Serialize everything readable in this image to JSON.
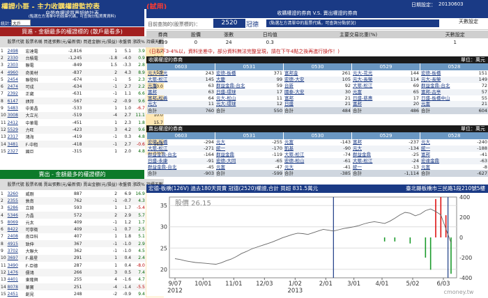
{
  "app": {
    "title": "權證小哥 - 主力收購權證監控表",
    "title_tag": "(試用)",
    "date_label": "日期設定：",
    "date": "20130603"
  },
  "left": {
    "subtitle": "自營商權證買賣超統計表",
    "subtitle2": "(點選左方清單中的股票代碼，可查詢分點買賣資料)",
    "select_label": "統計：",
    "select_value": "大戶",
    "buy": {
      "title": "買進 - 金額最多的權證標的 (散戶最看多)",
      "cols": [
        "",
        "股票代號",
        "股票名稱",
        "買進張數(元/最新價)",
        "買進金額(元/損益)",
        "收盤價",
        "漲跌%",
        "持續天數"
      ],
      "rows": [
        [
          "1",
          "2498",
          "宏達電",
          "-2,816",
          "1",
          "5.1",
          "3.9",
          "7.2"
        ],
        [
          "2",
          "2330",
          "台積電",
          "-1,245",
          "-1.8",
          "-4.0",
          "0.9",
          "10.0"
        ],
        [
          "3",
          "2303",
          "聯電",
          "-849",
          "1.5",
          "-3.3",
          "2.8",
          "5.0"
        ],
        [
          "4",
          "4960",
          "奇美材",
          "-837",
          "2",
          "4.3",
          "8.9",
          "5.9"
        ],
        [
          "5",
          "2454",
          "聯發科",
          "-674",
          "-1",
          "5",
          "2.3",
          "8.5"
        ],
        [
          "6",
          "2474",
          "可成",
          "-634",
          "-1",
          "2.7",
          "2.2",
          "10.0"
        ],
        [
          "7",
          "2392",
          "正崴",
          "-631",
          "-1",
          "1.1",
          "6.6",
          "13.1"
        ],
        [
          "8",
          "6147",
          "頎邦",
          "-567",
          "-2",
          "-0.9",
          "9.6",
          "10.0"
        ],
        [
          "9",
          "5483",
          "中美晶",
          "-533",
          "1",
          "1.0",
          "-6.7",
          "7.4"
        ],
        [
          "10",
          "3008",
          "大立光",
          "-519",
          "-4",
          "2.7",
          "11.1",
          "10.0"
        ],
        [
          "11",
          "2412",
          "中華電",
          "-451",
          "1",
          "2.3",
          "1.8",
          "15.7"
        ],
        [
          "12",
          "5529",
          "力旺",
          "-423",
          "3",
          "4.2",
          "9.6",
          "6.5"
        ],
        [
          "13",
          "2317",
          "鴻海",
          "-419",
          "-1",
          "0.3",
          "4.8",
          "6.7"
        ],
        [
          "14",
          "3481",
          "F-中租",
          "-418",
          "-1",
          "2.7",
          "-0.6",
          "16.3"
        ],
        [
          "15",
          "2327",
          "國巨",
          "-315",
          "1",
          "2.0",
          "4.8",
          "10.0"
        ]
      ]
    },
    "sell": {
      "title": "賣出 - 金額最多的權證標的",
      "cols": [
        "",
        "股票代號",
        "股票名稱",
        "賣出張數(元/最新價)",
        "賣出金額(元/損益)",
        "收盤價",
        "漲跌%",
        "持續天數"
      ],
      "rows": [
        [
          "1",
          "3260",
          "威剛",
          "887",
          "2",
          "6.9",
          "16.9",
          "-1.0"
        ],
        [
          "2",
          "2355",
          "敦南",
          "762",
          "-1",
          "-0.7",
          "4.3",
          "-17.4"
        ],
        [
          "3",
          "6286",
          "立錡",
          "593",
          "1",
          "1.7",
          "-5.4",
          "-4.2"
        ],
        [
          "4",
          "5346",
          "力晶",
          "572",
          "2",
          "2.9",
          "5.7",
          "-4.0"
        ],
        [
          "5",
          "8069",
          "元太",
          "409",
          "-1",
          "1.2",
          "1.7",
          "-4.4"
        ],
        [
          "6",
          "8422",
          "可寧衛",
          "409",
          "-1",
          "0.7",
          "2.5",
          "-4.1"
        ],
        [
          "7",
          "2408",
          "南亞科",
          "407",
          "1",
          "1.8",
          "5.1",
          "-2.2"
        ],
        [
          "8",
          "4915",
          "致伸",
          "367",
          "-1",
          "-1.0",
          "2.9",
          "-6.0"
        ],
        [
          "9",
          "3702",
          "大聯大",
          "362",
          "-1",
          "-1.0",
          "4.5",
          "-2.9"
        ],
        [
          "10",
          "3697",
          "F-晨星",
          "291",
          "1",
          "0.4",
          "2.4",
          "-2.0"
        ],
        [
          "11",
          "3490",
          "F-亞德",
          "287",
          "1",
          "0.4",
          "-8.0",
          "-1.2"
        ],
        [
          "12",
          "1476",
          "儒鴻",
          "266",
          "3",
          "0.5",
          "7.4",
          "-1.9"
        ],
        [
          "13",
          "4401",
          "東隆興",
          "255",
          "4",
          "-1.6",
          "4.7",
          "-6.7"
        ],
        [
          "14",
          "8078",
          "華寶",
          "251",
          "-4",
          "-1.4",
          "-5.5",
          "-6.9"
        ],
        [
          "15",
          "2451",
          "創見",
          "248",
          "-2",
          "-0.9",
          "9.4",
          "-1.1"
        ]
      ]
    }
  },
  "right": {
    "header": "收購權證的券商 V.S. 賣出權證的券商",
    "input_label": "目前查詢的(股票標的)：",
    "stock_code": "2520",
    "stock_name": "冠德",
    "hint": "(點選左方清單中的股票代碼，可查詢分點狀況)",
    "days_label": "天數設定",
    "stats_cols": [
      "券商",
      "股價",
      "張數",
      "日均值",
      "主要交易比重(%)",
      "天數設定"
    ],
    "stats_vals": [
      "839",
      "0",
      "24",
      "0.3",
      "",
      "1"
    ],
    "warning": "(日以下3-4%以，資料坐差中，部分資料無法完整呈現，請在下午4點之後再進行操作！)",
    "buy_block": {
      "title": "收購權證的券商",
      "subtitle": "(自營券商名稱 - 可查詢180日買賣記錄)",
      "unit": "單位：萬元",
      "dates": [
        "0603",
        "0531",
        "0530",
        "0529",
        "0528"
      ],
      "rows": [
        [
          [
            "元大-花光",
            "243"
          ],
          [
            "宏德-板橋",
            "371"
          ],
          [
            "富邦金",
            "261"
          ],
          [
            "元大-花光",
            "144"
          ],
          [
            "宏德-板橋",
            "151"
          ]
        ],
        [
          [
            "大眾-松江",
            "145"
          ],
          [
            "大慶",
            "99"
          ],
          [
            "宏德-大安",
            "105"
          ],
          [
            "元大-長榮",
            "114"
          ],
          [
            "元大-長榮",
            "149"
          ]
        ],
        [
          [
            "元富",
            "63"
          ],
          [
            "群益金鼎-台北",
            "59"
          ],
          [
            "台新",
            "92"
          ],
          [
            "大眾-松江",
            "69"
          ],
          [
            "群益金鼎-台北",
            "72"
          ]
        ],
        [
          [
            "富邦",
            "63"
          ],
          [
            "日盛-環球",
            "17"
          ],
          [
            "國泰-大安",
            "30"
          ],
          [
            "元富",
            "65"
          ],
          [
            "富邦-古亭",
            "57"
          ]
        ],
        [
          [
            "富邦-松義",
            "64"
          ],
          [
            "元大-松山",
            "11"
          ],
          [
            "富邦",
            "21"
          ],
          [
            "日盛-慈惠",
            "17"
          ],
          [
            "日盛-板橋中山",
            "55"
          ]
        ],
        [
          [
            "元大",
            "11"
          ],
          [
            "元大-環球",
            "12"
          ],
          [
            "日盛",
            "21"
          ],
          [
            "富邦",
            "20"
          ],
          [
            "元富",
            "21"
          ]
        ]
      ],
      "totals": [
        "760",
        "550",
        "484",
        "486",
        "604"
      ]
    },
    "sell_block": {
      "title": "賣出權證的券商",
      "unit": "單位：萬元",
      "dates": [
        "0603",
        "0531",
        "0530",
        "0529",
        "0528"
      ],
      "rows": [
        [
          [
            "宏德-板橋",
            "-294"
          ],
          [
            "元大",
            "-255"
          ],
          [
            "元富",
            "-143"
          ],
          [
            "富邦",
            "-237"
          ],
          [
            "元大",
            "-240"
          ]
        ],
        [
          [
            "大眾-松江",
            "-271"
          ],
          [
            "統一",
            "-170"
          ],
          [
            "凱基",
            "-90"
          ],
          [
            "元大",
            "-134"
          ],
          [
            "統一",
            "-188"
          ]
        ],
        [
          [
            "群益金鼎-台北",
            "-164"
          ],
          [
            "群益金鼎",
            "-119"
          ],
          [
            "大眾-松江",
            "-74"
          ],
          [
            "群益金鼎",
            "-25"
          ],
          [
            "富邦",
            "-41"
          ]
        ],
        [
          [
            "日盛-永康",
            "-91"
          ],
          [
            "宏德-大同",
            "-65"
          ],
          [
            "宏德-松山",
            "-61"
          ],
          [
            "大眾-松江",
            "-24"
          ],
          [
            "宏達金鼎",
            "-63"
          ]
        ],
        [
          [
            "群益金鼎-台北",
            "-45"
          ],
          [
            "元富",
            "-47"
          ],
          [
            "元大",
            "-41"
          ],
          [
            "統一",
            "-13"
          ],
          [
            "元富",
            "-8"
          ]
        ]
      ],
      "totals": [
        "-903",
        "-599",
        "-385",
        "-1,114",
        "-627"
      ]
    },
    "chart": {
      "title": "宏德-板橋(126V) 過去180天買賣 冠德(2520)權證,合計 買超 831.5萬元",
      "address": "臺北縣板橋市三民路1段210號5樓",
      "price_label": "股價",
      "price_value": "26.15",
      "watermark": "cmoney.tw"
    }
  },
  "chart_data": {
    "type": "line",
    "title": "",
    "xlabel": "",
    "ylabel": "",
    "x_ticks": [
      "9/07\n2012",
      "10/01",
      "11/01",
      "12/03",
      "1/02\n2013",
      "2/01",
      "3/01",
      "4/01",
      "5/02",
      "6/03"
    ],
    "ylim_left": [
      18,
      37
    ],
    "ylim_right": [
      -400,
      400
    ],
    "left_ticks": [
      20,
      25,
      30,
      35
    ],
    "right_ticks": [
      -400,
      -200,
      0,
      200,
      400
    ],
    "series": [
      {
        "name": "股價",
        "values": [
          22.5,
          22.3,
          22.0,
          21.8,
          21.6,
          21.5,
          21.4,
          21.3,
          21.2,
          21.5,
          22.0,
          22.4,
          23.0,
          23.7,
          24.2,
          24.8,
          25.2,
          25.6,
          26.0,
          26.4,
          26.9,
          27.4,
          27.8,
          28.2,
          28.5,
          28.4,
          28.2,
          28.6,
          29.0,
          29.4,
          29.2,
          29.0,
          29.3,
          29.6,
          29.8,
          30.0,
          30.3,
          30.7,
          31.0,
          31.2,
          31.0,
          30.8,
          31.3,
          32.0,
          32.8,
          33.4,
          33.2,
          32.6,
          33.0,
          33.8,
          34.2,
          33.6,
          32.8,
          29.5,
          26.2
        ]
      }
    ],
    "flows": [
      {
        "i": 49,
        "v": -200
      },
      {
        "i": 50,
        "v": -320
      },
      {
        "i": 51,
        "v": 380
      },
      {
        "i": 52,
        "v": 400
      },
      {
        "i": 53,
        "v": 220
      },
      {
        "i": 54,
        "v": -360
      },
      {
        "i": 46,
        "v": -60
      },
      {
        "i": 43,
        "v": -40
      },
      {
        "i": 41,
        "v": -40
      }
    ]
  }
}
